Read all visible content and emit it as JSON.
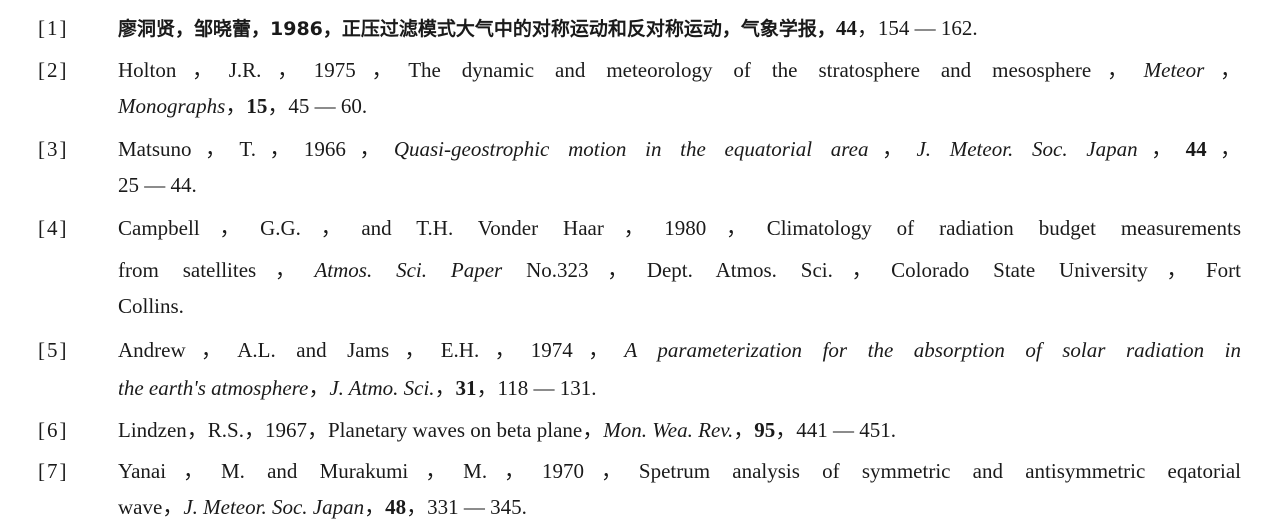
{
  "references": [
    {
      "number": "[1]",
      "lines": [
        [
          {
            "text": "廖洞贤，邹晓蕾，1986，正压过滤模式大气中的对称运动和反对称运动，气象学报，",
            "style": "cjk"
          },
          {
            "text": "44",
            "style": "b"
          },
          {
            "text": "，154 — 162.",
            "style": ""
          }
        ]
      ]
    },
    {
      "number": "[2]",
      "lines": [
        [
          {
            "text": "Holton，J.R.，1975，The dynamic and meteorology of the stratosphere and mesosphere，",
            "style": ""
          },
          {
            "text": "Meteor",
            "style": "i"
          },
          {
            "text": "，",
            "style": ""
          }
        ],
        [
          {
            "text": "Monographs",
            "style": "i"
          },
          {
            "text": "，",
            "style": ""
          },
          {
            "text": "15",
            "style": "b"
          },
          {
            "text": "，45 — 60.",
            "style": ""
          }
        ]
      ]
    },
    {
      "number": "[3]",
      "lines": [
        [
          {
            "text": "Matsuno，T.，1966，",
            "style": ""
          },
          {
            "text": "Quasi-geostrophic motion in the equatorial area",
            "style": "i"
          },
          {
            "text": "，",
            "style": ""
          },
          {
            "text": "J. Meteor. Soc. Japan",
            "style": "i"
          },
          {
            "text": "，",
            "style": ""
          },
          {
            "text": "44",
            "style": "b"
          },
          {
            "text": "，",
            "style": ""
          }
        ],
        [
          {
            "text": "25 — 44.",
            "style": ""
          }
        ]
      ]
    },
    {
      "number": "[4]",
      "lines": [
        [
          {
            "text": "Campbell，G.G.，and T.H. Vonder Haar，1980，Climatology of radiation budget measurements",
            "style": ""
          }
        ],
        [
          {
            "text": "from satellites，",
            "style": ""
          },
          {
            "text": "Atmos. Sci. Paper",
            "style": "i"
          },
          {
            "text": " No.323，Dept. Atmos. Sci.，Colorado State University，Fort",
            "style": ""
          }
        ],
        [
          {
            "text": "Collins.",
            "style": ""
          }
        ]
      ]
    },
    {
      "number": "[5]",
      "lines": [
        [
          {
            "text": "Andrew，A.L. and Jams，E.H.，1974，",
            "style": ""
          },
          {
            "text": "A parameterization for the absorption of solar radiation in",
            "style": "i"
          }
        ],
        [
          {
            "text": "the earth's atmosphere",
            "style": "i"
          },
          {
            "text": "，",
            "style": ""
          },
          {
            "text": "J. Atmo. Sci.",
            "style": "i"
          },
          {
            "text": "，",
            "style": ""
          },
          {
            "text": "31",
            "style": "b"
          },
          {
            "text": "，118 — 131.",
            "style": ""
          }
        ]
      ]
    },
    {
      "number": "[6]",
      "lines": [
        [
          {
            "text": "Lindzen，R.S.，1967，Planetary waves on beta plane，",
            "style": ""
          },
          {
            "text": "Mon. Wea. Rev.",
            "style": "i"
          },
          {
            "text": "，",
            "style": ""
          },
          {
            "text": "95",
            "style": "b"
          },
          {
            "text": "，441 — 451.",
            "style": ""
          }
        ]
      ]
    },
    {
      "number": "[7]",
      "lines": [
        [
          {
            "text": "Yanai，M. and Murakumi，M.，1970，Spetrum analysis of symmetric and antisymmetric eqatorial",
            "style": ""
          }
        ],
        [
          {
            "text": "wave，",
            "style": ""
          },
          {
            "text": "J. Meteor. Soc. Japan",
            "style": "i"
          },
          {
            "text": "，",
            "style": ""
          },
          {
            "text": "48",
            "style": "b"
          },
          {
            "text": "，331 — 345.",
            "style": ""
          }
        ]
      ]
    }
  ]
}
